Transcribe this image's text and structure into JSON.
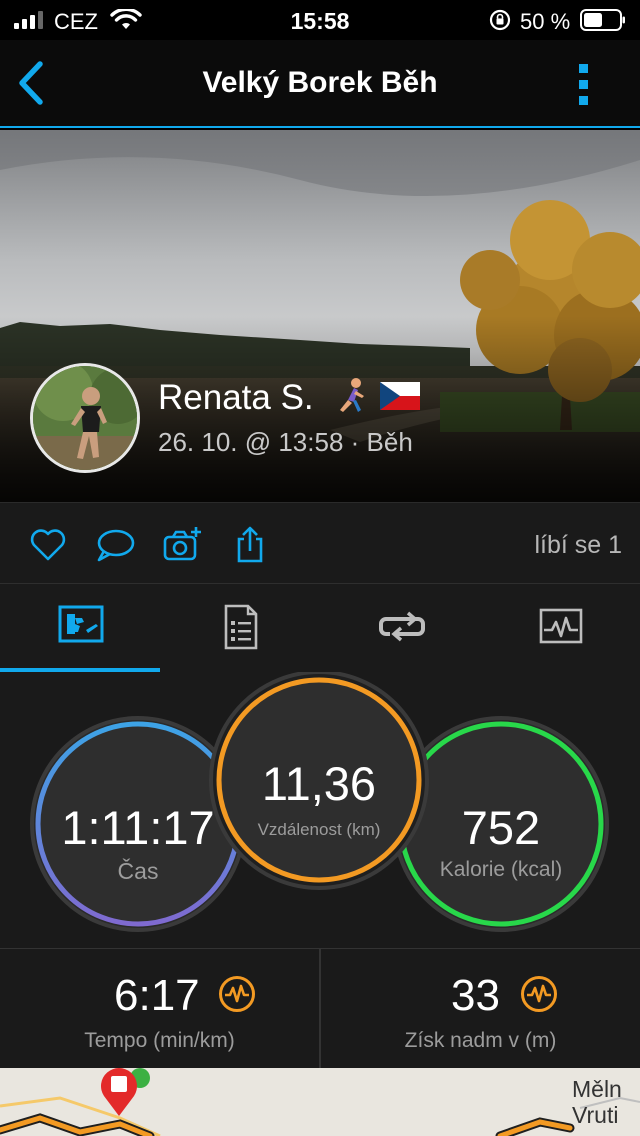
{
  "status_bar": {
    "carrier": "CEZ",
    "time": "15:58",
    "battery": "50 %"
  },
  "nav": {
    "title": "Velký Borek Běh"
  },
  "activity": {
    "user_name": "Renata S.",
    "meta": "26. 10. @ 13:58 · Běh"
  },
  "social": {
    "likes": "líbí se 1"
  },
  "tabs": [
    {
      "icon": "stats-icon",
      "active": true
    },
    {
      "icon": "details-icon",
      "active": false
    },
    {
      "icon": "laps-icon",
      "active": false
    },
    {
      "icon": "chart-icon",
      "active": false
    }
  ],
  "rings": {
    "time": {
      "value": "1:11:17",
      "label": "Čas"
    },
    "distance": {
      "value": "11,36",
      "label": "Vzdálenost (km)"
    },
    "calories": {
      "value": "752",
      "label": "Kalorie (kcal)"
    }
  },
  "summary": {
    "pace": {
      "value": "6:17",
      "label": "Tempo (min/km)"
    },
    "elevation": {
      "value": "33",
      "label": "Získ nadm v (m)"
    }
  },
  "map": {
    "label": "Měln Vruti"
  },
  "colors": {
    "accent": "#11a9ed",
    "time_ring": "#4a8fe0",
    "distance_ring": "#f39a23",
    "calories_ring": "#28d84a",
    "panel": "#1a1a1a",
    "metric_icon": "#f39a23"
  }
}
